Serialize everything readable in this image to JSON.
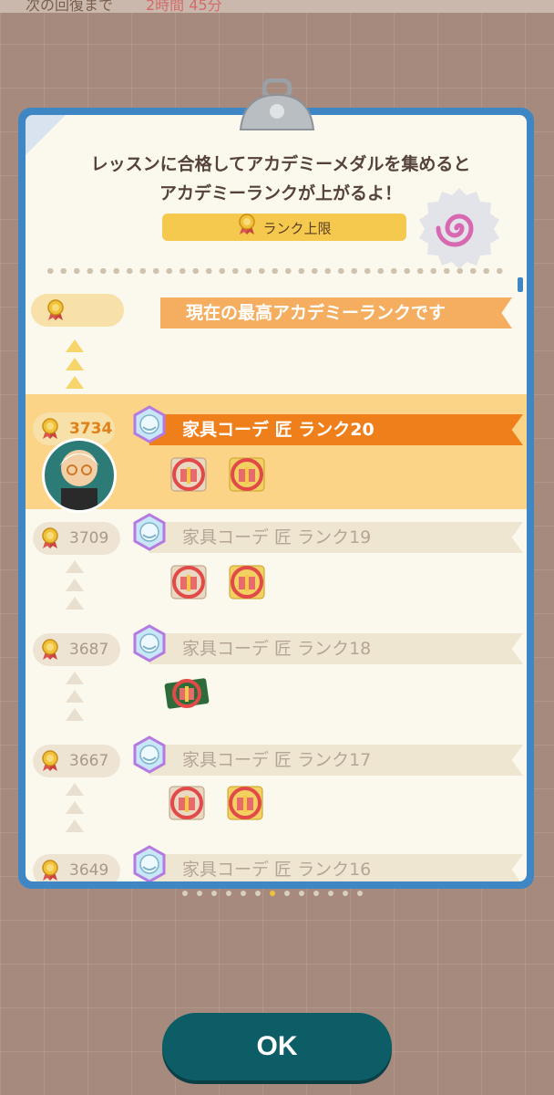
{
  "topbar": {
    "text_left": "次の回復まで",
    "text_right": "2時間 45分"
  },
  "dialog": {
    "message_line1": "レッスンに合格してアカデミーメダルを集めると",
    "message_line2": "アカデミーランクが上がるよ！",
    "limit_label": "ランク上限"
  },
  "top_rank": {
    "label": "現在の最高アカデミーランクです"
  },
  "ranks": [
    {
      "medals": "3734",
      "title": "家具コーデ 匠 ランク20",
      "current": true
    },
    {
      "medals": "3709",
      "title": "家具コーデ 匠 ランク19",
      "current": false
    },
    {
      "medals": "3687",
      "title": "家具コーデ 匠 ランク18",
      "current": false
    },
    {
      "medals": "3667",
      "title": "家具コーデ 匠 ランク17",
      "current": false
    },
    {
      "medals": "3649",
      "title": "家具コーデ 匠 ランク16",
      "current": false
    }
  ],
  "buttons": {
    "ok_label": "OK"
  },
  "colors": {
    "panel_frame": "#3f86c4",
    "current_highlight": "#fbd488",
    "current_title": "#ef7f1a",
    "ok_button": "#0c5d66"
  },
  "icons": [
    "academy-medal-icon",
    "rank-badge-icon",
    "gift-scroll-icon",
    "swirl-icon",
    "clipboard-clip-icon",
    "up-arrow-icon"
  ]
}
